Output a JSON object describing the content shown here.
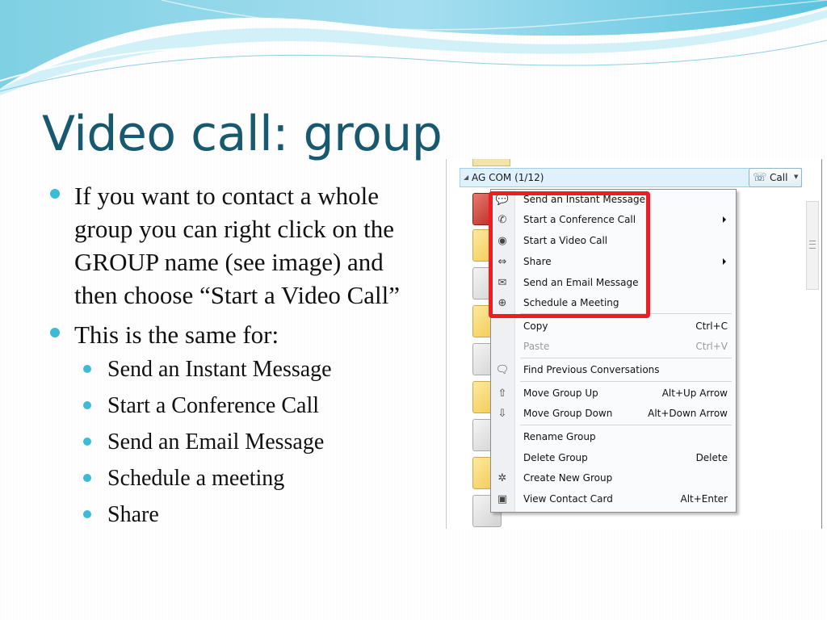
{
  "slide": {
    "title": "Video call: group",
    "bullets": [
      "If you want to contact a whole group you can right click on the GROUP name (see image) and then choose “Start a Video Call”",
      "This is the same for:"
    ],
    "sub_bullets": [
      "Send an Instant Message",
      "Start a Conference Call",
      "Send an Email Message",
      "Schedule a meeting",
      "Share"
    ],
    "accent_color": "#17596e",
    "bullet_color": "#3cbbd6"
  },
  "screenshot": {
    "group_name": "AG COM (1/12)",
    "call_button_label": "Call",
    "highlight_color": "#ee1c25",
    "menu": [
      {
        "label": "Send an Instant Message",
        "shortcut": "",
        "icon": "im-icon"
      },
      {
        "label": "Start a Conference Call",
        "shortcut": "",
        "icon": "phone-icon",
        "submenu": true
      },
      {
        "label": "Start a Video Call",
        "shortcut": "",
        "icon": "webcam-icon"
      },
      {
        "label": "Share",
        "shortcut": "",
        "icon": "share-icon",
        "submenu": true
      },
      {
        "label": "Send an Email Message",
        "shortcut": "",
        "icon": "email-icon"
      },
      {
        "label": "Schedule a Meeting",
        "shortcut": "",
        "icon": "meeting-icon"
      },
      {
        "label": "Copy",
        "shortcut": "Ctrl+C"
      },
      {
        "label": "Paste",
        "shortcut": "Ctrl+V",
        "disabled": true
      },
      {
        "label": "Find Previous Conversations",
        "shortcut": "",
        "icon": "conversation-history-icon"
      },
      {
        "label": "Move Group Up",
        "shortcut": "Alt+Up Arrow",
        "icon": "arrow-up-icon"
      },
      {
        "label": "Move Group Down",
        "shortcut": "Alt+Down Arrow",
        "icon": "arrow-down-icon"
      },
      {
        "label": "Rename Group",
        "shortcut": ""
      },
      {
        "label": "Delete Group",
        "shortcut": "Delete"
      },
      {
        "label": "Create New Group",
        "shortcut": "",
        "icon": "new-group-icon"
      },
      {
        "label": "View Contact Card",
        "shortcut": "Alt+Enter",
        "icon": "contact-card-icon"
      }
    ]
  }
}
